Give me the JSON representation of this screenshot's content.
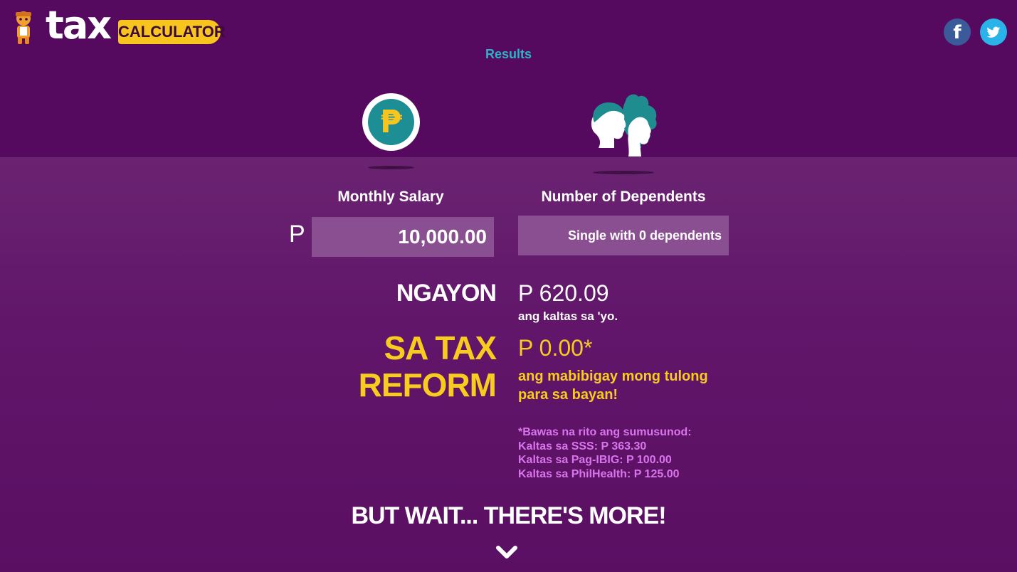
{
  "header": {
    "logo_word": "tax",
    "logo_badge": "CALCULATOR",
    "social": {
      "facebook_icon": "facebook-icon",
      "facebook_glyph": "f",
      "facebook_color": "#3b5a9a",
      "twitter_icon": "twitter-icon",
      "twitter_color": "#29b3e8"
    }
  },
  "nav": {
    "results_label": "Results"
  },
  "icons": {
    "salary": "peso-coin-icon",
    "salary_glyph": "₱",
    "dependents": "family-heads-icon"
  },
  "form": {
    "salary_label": "Monthly Salary",
    "currency_symbol": "P",
    "salary_value": "10,000.00",
    "dependents_label": "Number of Dependents",
    "dependents_value": "Single with 0 dependents"
  },
  "results": {
    "current_heading": "NGAYON",
    "current_amount": "P 620.09",
    "current_caption": "ang kaltas sa 'yo.",
    "reform_heading_line1": "SA TAX",
    "reform_heading_line2": "REFORM",
    "reform_amount": "P 0.00*",
    "reform_caption_line1": "ang mabibigay mong tulong",
    "reform_caption_line2": "para sa bayan!",
    "deductions": [
      "*Bawas na rito ang sumusunod:",
      "Kaltas sa SSS: P 363.30",
      "Kaltas sa Pag-IBIG: P 100.00",
      "Kaltas sa PhilHealth: P 125.00"
    ]
  },
  "footer": {
    "more_heading": "BUT WAIT... THERE'S MORE!",
    "scroll_icon": "chevron-down-icon"
  },
  "colors": {
    "background": "#5e1466",
    "accent_yellow": "#f7cc1e",
    "accent_teal": "#2bb5c4",
    "deduction_pink": "#d975ec",
    "input_bg": "#8a4f91"
  }
}
